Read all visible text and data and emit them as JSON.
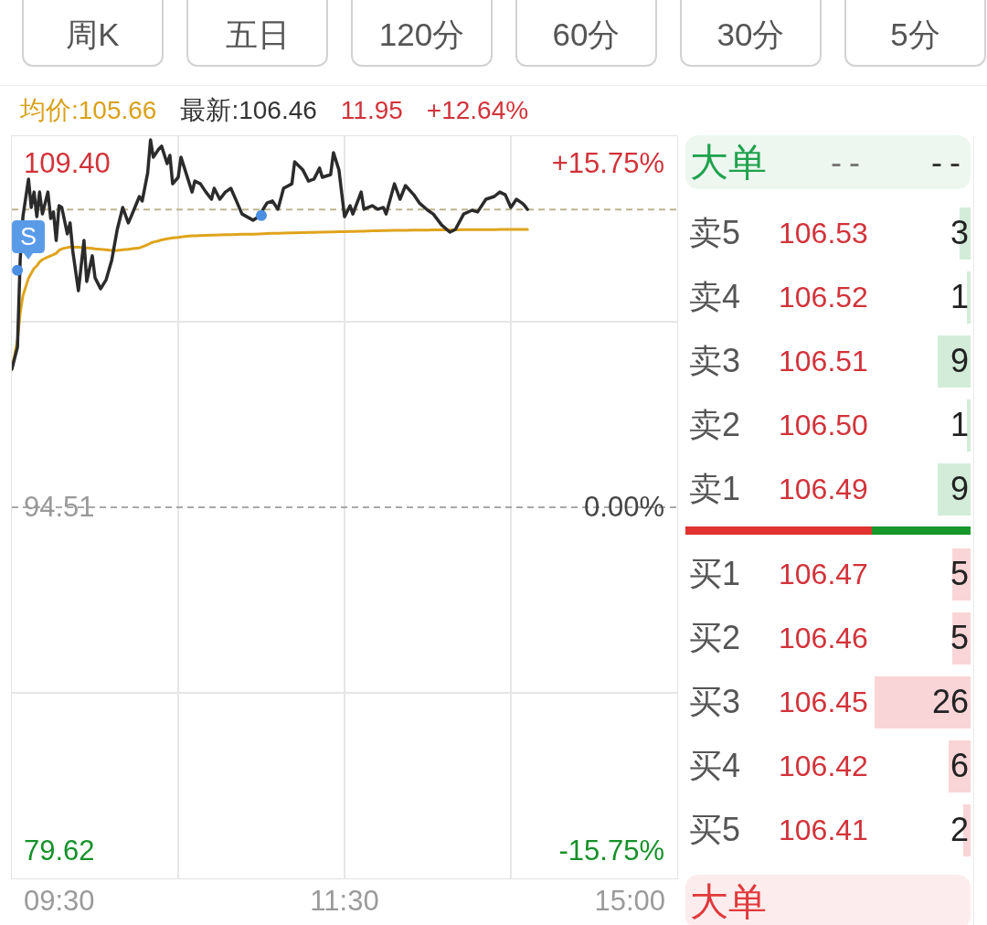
{
  "period_tabs": [
    {
      "label": "周K",
      "selected": false
    },
    {
      "label": "五日",
      "selected": false
    },
    {
      "label": "120分",
      "selected": false
    },
    {
      "label": "60分",
      "selected": false
    },
    {
      "label": "30分",
      "selected": false
    },
    {
      "label": "5分",
      "selected": false
    }
  ],
  "quote": {
    "avg_price": "均价:105.66",
    "latest": "最新:106.46",
    "change": "11.95",
    "change_pct": "+12.64%"
  },
  "chart": {
    "price_labels": [
      "109.40",
      "94.51",
      "79.62"
    ],
    "percent_labels": [
      "+15.75%",
      "0.00%",
      "-15.75%"
    ],
    "marker_label": "S",
    "time_labels": [
      "09:30",
      "11:30",
      "15:00"
    ]
  },
  "order_book": {
    "sell": {
      "big_order": {
        "label": "大单",
        "values": [
          "--",
          "--"
        ]
      },
      "levels": [
        {
          "label": "卖5",
          "price": "106.53",
          "volume": "3"
        },
        {
          "label": "卖4",
          "price": "106.52",
          "volume": "1"
        },
        {
          "label": "卖3",
          "price": "106.51",
          "volume": "9"
        },
        {
          "label": "卖2",
          "price": "106.50",
          "volume": "1"
        },
        {
          "label": "卖1",
          "price": "106.49",
          "volume": "9"
        }
      ]
    },
    "ratio_bar": {
      "level": 0.654
    },
    "buy": {
      "levels": [
        {
          "label": "买1",
          "price": "106.47",
          "volume": "5"
        },
        {
          "label": "买2",
          "price": "106.46",
          "volume": "5"
        },
        {
          "label": "买3",
          "price": "106.45",
          "volume": "26"
        },
        {
          "label": "买4",
          "price": "106.42",
          "volume": "6"
        },
        {
          "label": "买5",
          "price": "106.41",
          "volume": "2"
        }
      ],
      "big_order": {
        "label": "大单"
      }
    }
  }
}
